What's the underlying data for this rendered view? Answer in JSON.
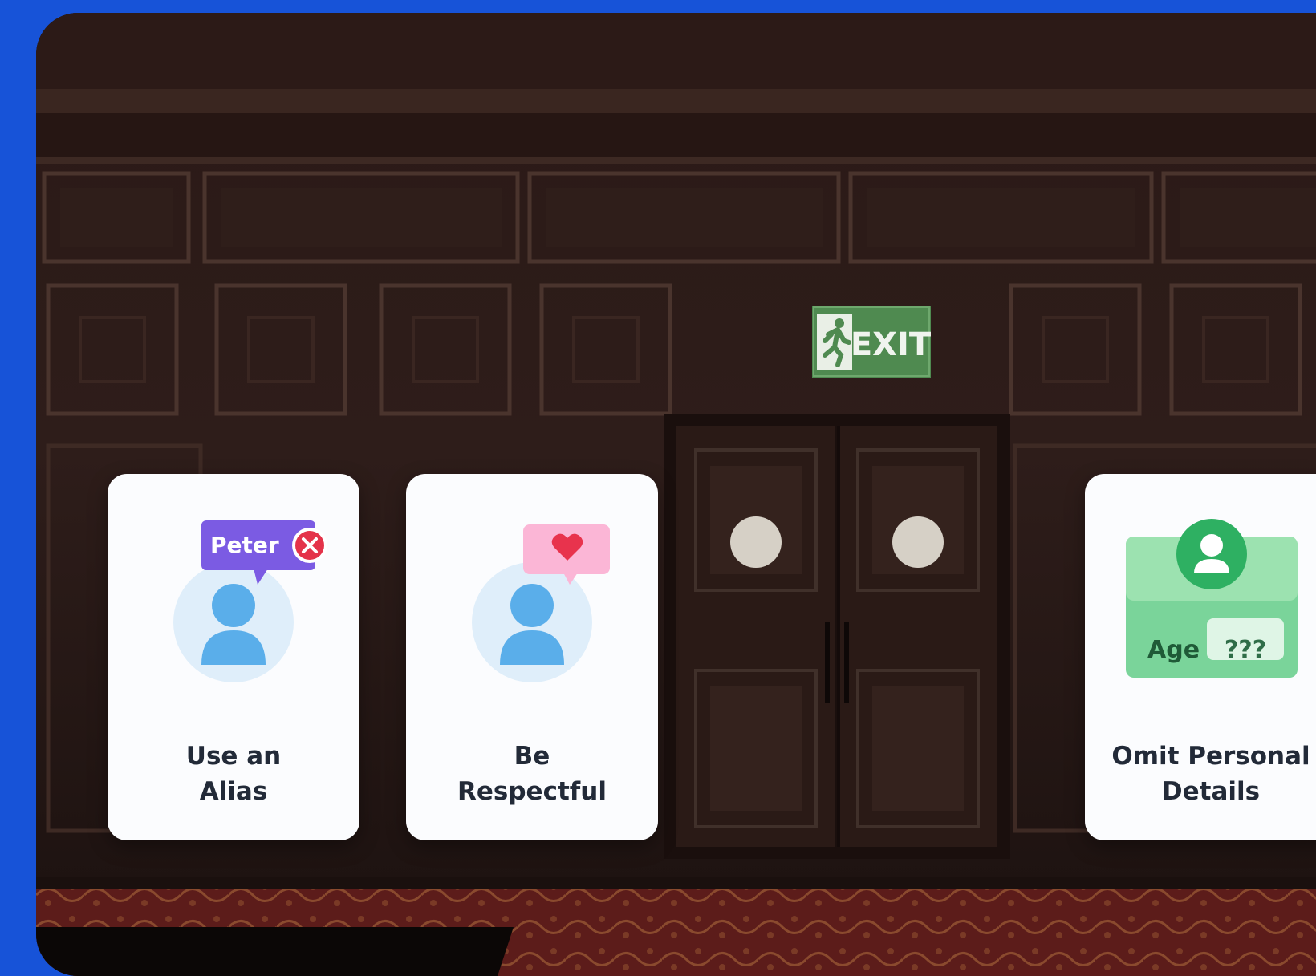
{
  "scene": {
    "exit_sign": "EXIT",
    "colors": {
      "background": "#1753d8",
      "wall": "#2b1b18",
      "carpet": "#5a1b1a",
      "exit_green": "#4f8a50"
    }
  },
  "cards": [
    {
      "title": "Use an\nAlias",
      "bubble_name": "Peter",
      "icon": "alias-person-icon"
    },
    {
      "title": "Be\nRespectful",
      "icon": "respect-person-icon"
    },
    {
      "title": "Omit Personal\nDetails",
      "age_label": "Age",
      "age_value": "???",
      "icon": "id-card-icon"
    }
  ]
}
